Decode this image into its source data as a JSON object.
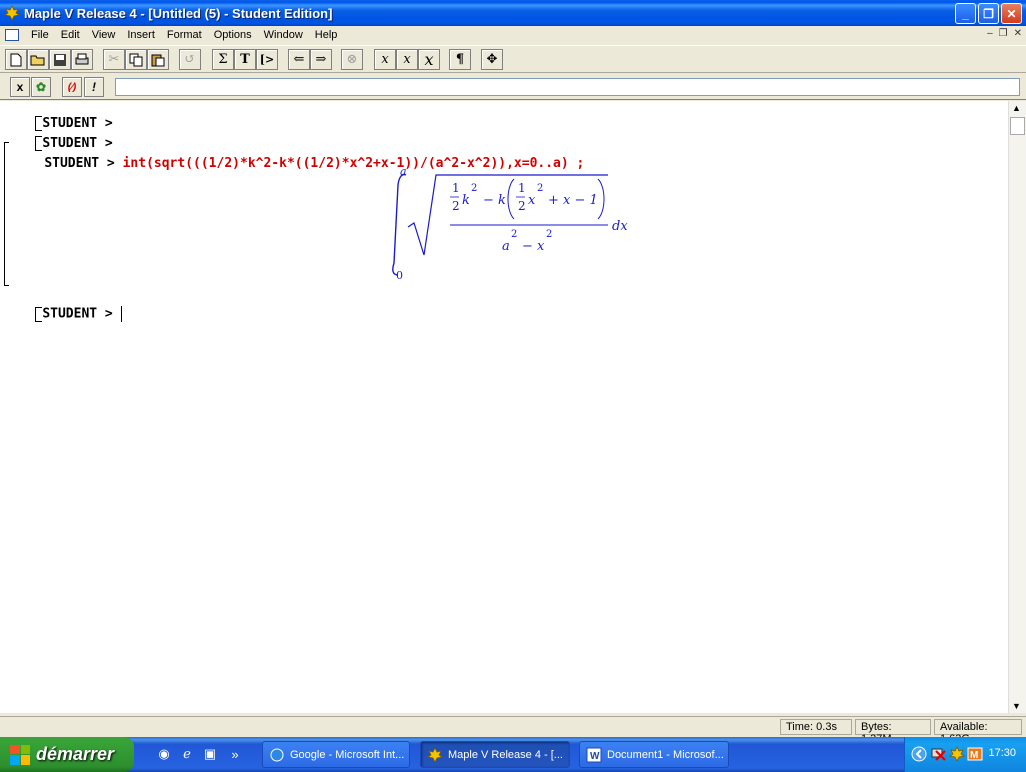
{
  "window": {
    "title": "Maple V Release 4 - [Untitled (5) - Student Edition]",
    "minimize": "_",
    "restore": "❐",
    "close": "✕"
  },
  "menu": {
    "items": [
      "File",
      "Edit",
      "View",
      "Insert",
      "Format",
      "Options",
      "Window",
      "Help"
    ]
  },
  "toolbar": {
    "sigma": "Σ",
    "text": "T",
    "prompt": "[>",
    "para": "¶",
    "x1": "x",
    "x2": "x",
    "x3": "x"
  },
  "context_bar": {
    "x_label": "x",
    "exclaim": "!",
    "input_value": ""
  },
  "worksheet": {
    "prompt": "STUDENT >",
    "lines": [
      {
        "prompt": "STUDENT >",
        "command": ""
      },
      {
        "prompt": "STUDENT >",
        "command": ""
      },
      {
        "prompt": "STUDENT >",
        "command": "int(sqrt(((1/2)*k^2-k*((1/2)*x^2+x-1))/(a^2-x^2)),x=0..a) ;"
      },
      {
        "prompt": "STUDENT >",
        "command": ""
      }
    ],
    "output": {
      "upper_limit": "a",
      "lower_limit": "0",
      "num_half1_num": "1",
      "num_half1_den": "2",
      "k": "k",
      "exp2": "2",
      "minus_k": "− k",
      "half2_num": "1",
      "half2_den": "2",
      "x": "x",
      "plus_x_minus_1": "+ x − 1",
      "den_a": "a",
      "den_minus_x": "− x",
      "dx": "dx"
    }
  },
  "status": {
    "time": "Time:   0.3s",
    "bytes": "Bytes: 1.37M",
    "available": "Available: 1.63G"
  },
  "taskbar": {
    "start_label": "démarrer",
    "tasks": [
      {
        "label": "Google - Microsoft Int..."
      },
      {
        "label": "Maple V Release 4 - [..."
      },
      {
        "label": "Document1 - Microsof..."
      }
    ],
    "clock": "17:30",
    "more": "»"
  }
}
